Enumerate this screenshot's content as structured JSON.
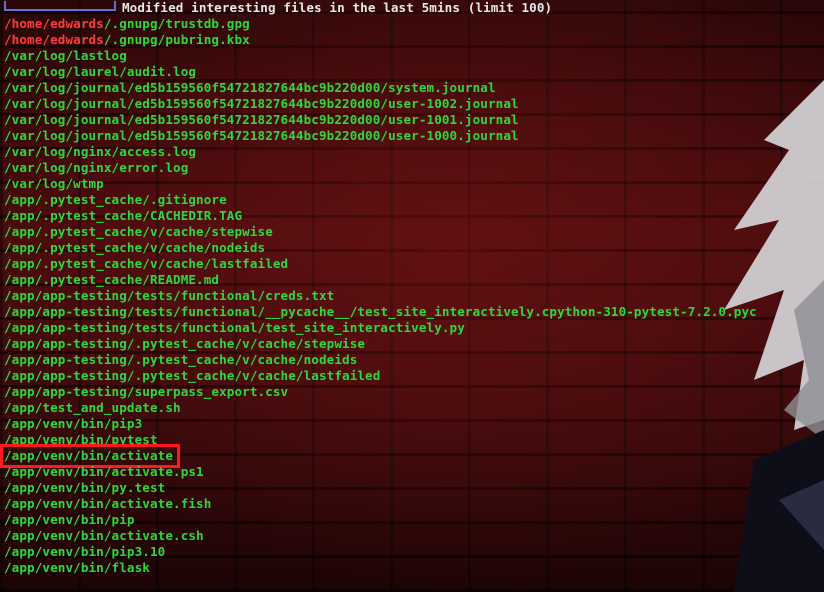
{
  "header": {
    "title": "Modified interesting files in the last 5mins (limit 100)"
  },
  "colors": {
    "green": "#2fd83a",
    "red": "#ff3b3b",
    "highlight_box": "#ff1a1a",
    "header_text": "#e8e8e8"
  },
  "lines": [
    {
      "prefix": "/home/edwards",
      "rest": "/.gnupg/trustdb.gpg"
    },
    {
      "prefix": "/home/edwards",
      "rest": "/.gnupg/pubring.kbx"
    },
    {
      "prefix": "",
      "rest": "/var/log/lastlog"
    },
    {
      "prefix": "",
      "rest": "/var/log/laurel/audit.log"
    },
    {
      "prefix": "",
      "rest": "/var/log/journal/ed5b159560f54721827644bc9b220d00/system.journal"
    },
    {
      "prefix": "",
      "rest": "/var/log/journal/ed5b159560f54721827644bc9b220d00/user-1002.journal"
    },
    {
      "prefix": "",
      "rest": "/var/log/journal/ed5b159560f54721827644bc9b220d00/user-1001.journal"
    },
    {
      "prefix": "",
      "rest": "/var/log/journal/ed5b159560f54721827644bc9b220d00/user-1000.journal"
    },
    {
      "prefix": "",
      "rest": "/var/log/nginx/access.log"
    },
    {
      "prefix": "",
      "rest": "/var/log/nginx/error.log"
    },
    {
      "prefix": "",
      "rest": "/var/log/wtmp"
    },
    {
      "prefix": "",
      "rest": "/app/.pytest_cache/.gitignore"
    },
    {
      "prefix": "",
      "rest": "/app/.pytest_cache/CACHEDIR.TAG"
    },
    {
      "prefix": "",
      "rest": "/app/.pytest_cache/v/cache/stepwise"
    },
    {
      "prefix": "",
      "rest": "/app/.pytest_cache/v/cache/nodeids"
    },
    {
      "prefix": "",
      "rest": "/app/.pytest_cache/v/cache/lastfailed"
    },
    {
      "prefix": "",
      "rest": "/app/.pytest_cache/README.md"
    },
    {
      "prefix": "",
      "rest": "/app/app-testing/tests/functional/creds.txt"
    },
    {
      "prefix": "",
      "rest": "/app/app-testing/tests/functional/__pycache__/test_site_interactively.cpython-310-pytest-7.2.0.pyc"
    },
    {
      "prefix": "",
      "rest": "/app/app-testing/tests/functional/test_site_interactively.py"
    },
    {
      "prefix": "",
      "rest": "/app/app-testing/.pytest_cache/v/cache/stepwise"
    },
    {
      "prefix": "",
      "rest": "/app/app-testing/.pytest_cache/v/cache/nodeids"
    },
    {
      "prefix": "",
      "rest": "/app/app-testing/.pytest_cache/v/cache/lastfailed"
    },
    {
      "prefix": "",
      "rest": "/app/app-testing/superpass_export.csv"
    },
    {
      "prefix": "",
      "rest": "/app/test_and_update.sh"
    },
    {
      "prefix": "",
      "rest": "/app/venv/bin/pip3"
    },
    {
      "prefix": "",
      "rest": "/app/venv/bin/pytest"
    },
    {
      "prefix": "",
      "rest": "/app/venv/bin/activate",
      "boxed": true
    },
    {
      "prefix": "",
      "rest": "/app/venv/bin/activate.ps1"
    },
    {
      "prefix": "",
      "rest": "/app/venv/bin/py.test"
    },
    {
      "prefix": "",
      "rest": "/app/venv/bin/activate.fish"
    },
    {
      "prefix": "",
      "rest": "/app/venv/bin/pip"
    },
    {
      "prefix": "",
      "rest": "/app/venv/bin/activate.csh"
    },
    {
      "prefix": "",
      "rest": "/app/venv/bin/pip3.10"
    },
    {
      "prefix": "",
      "rest": "/app/venv/bin/flask"
    }
  ]
}
